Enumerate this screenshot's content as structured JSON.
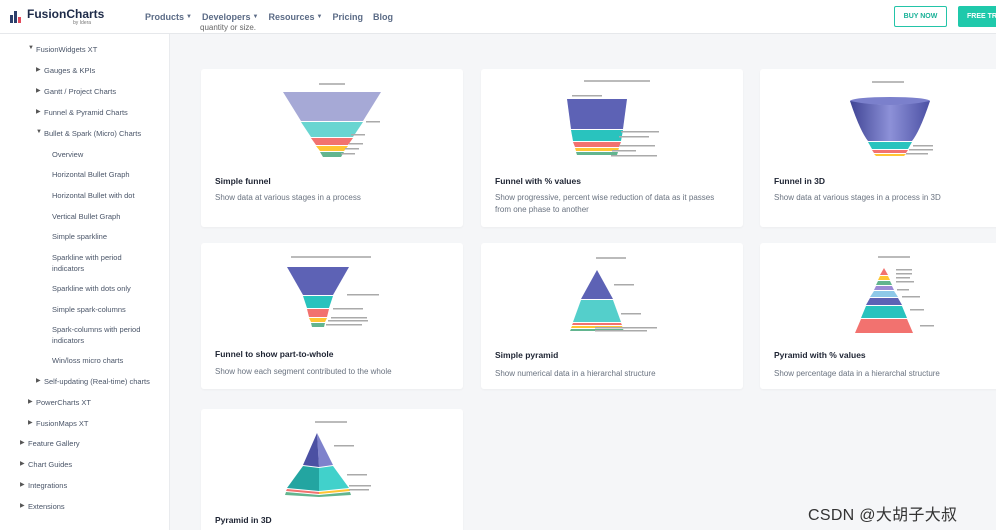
{
  "brand": {
    "name": "FusionCharts",
    "sub": "by Idera"
  },
  "nav": {
    "products": "Products",
    "developers": "Developers",
    "resources": "Resources",
    "pricing": "Pricing",
    "blog": "Blog",
    "buy_now": "BUY NOW",
    "free_trial": "FREE TR"
  },
  "sidebar": {
    "items": [
      "FusionWidgets XT",
      "Gauges & KPIs",
      "Gantt / Project Charts",
      "Funnel & Pyramid Charts",
      "Bullet & Spark (Micro) Charts",
      "Overview",
      "Horizontal Bullet Graph",
      "Horizontal Bullet with dot",
      "Vertical Bullet Graph",
      "Simple sparkline",
      "Sparkline with period indicators",
      "Sparkline with dots only",
      "Simple spark-columns",
      "Spark-columns with period indicators",
      "Win/loss micro charts",
      "Self-updating (Real-time) charts",
      "PowerCharts XT",
      "FusionMaps XT",
      "Feature Gallery",
      "Chart Guides",
      "Integrations",
      "Extensions"
    ]
  },
  "top_cut_text": "quantity or size.",
  "cards": [
    {
      "title": "Simple funnel",
      "desc": "Show data at various stages in a process"
    },
    {
      "title": "Funnel with % values",
      "desc": "Show progressive, percent wise reduction of data as it passes from one phase to another"
    },
    {
      "title": "Funnel in 3D",
      "desc": "Show data at various stages in a process in 3D"
    },
    {
      "title": "Funnel to show part-to-whole",
      "desc": "Show how each segment contributed to the whole"
    },
    {
      "title": "Simple pyramid",
      "desc": "Show numerical data in a hierarchal structure"
    },
    {
      "title": "Pyramid with % values",
      "desc": "Show percentage data in a hierarchal structure"
    },
    {
      "title": "Pyramid in 3D",
      "desc": ""
    }
  ],
  "watermark": "CSDN @大胡子大叔",
  "colors": {
    "accent": "#1fc9ab",
    "purple": "#5d62b5",
    "teal": "#29c3be",
    "orange": "#f2726f",
    "yellow": "#ffc533",
    "green": "#62b58f"
  }
}
